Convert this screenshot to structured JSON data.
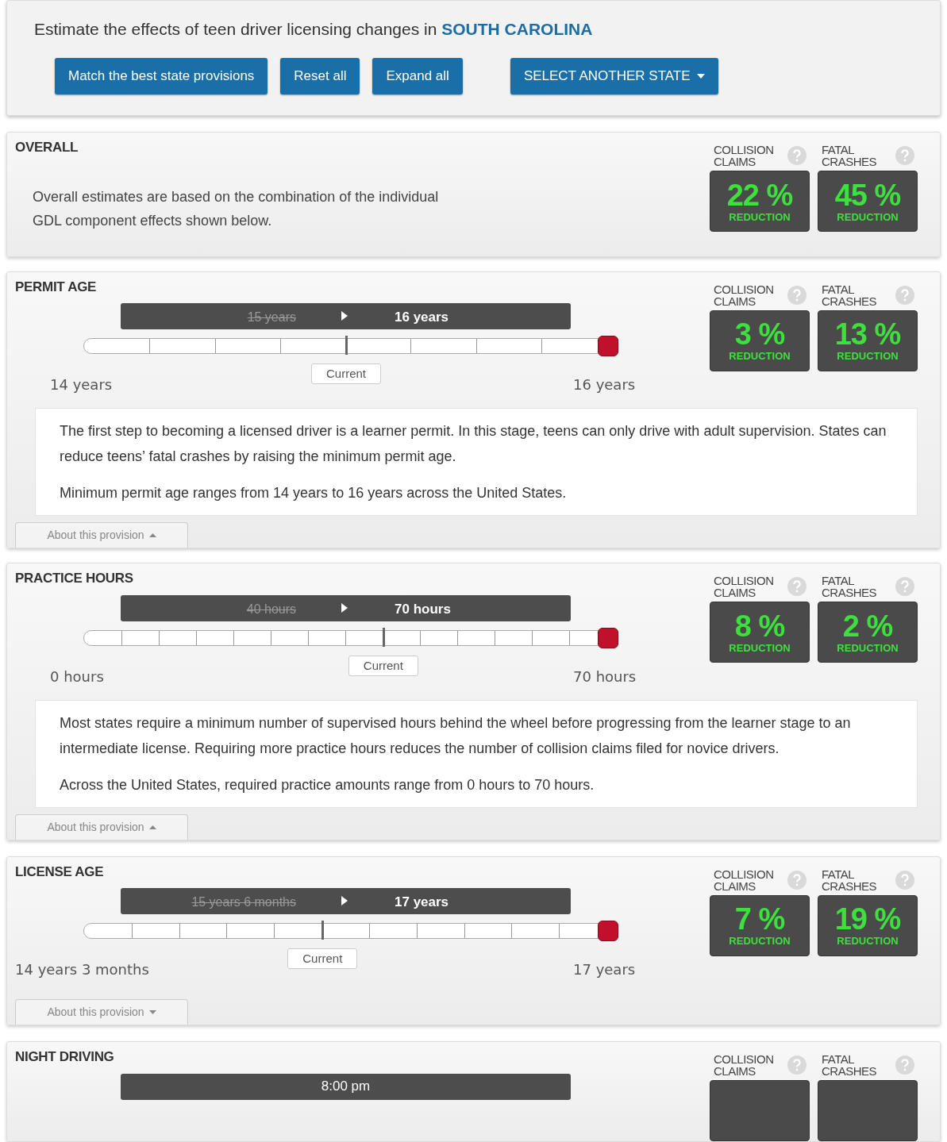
{
  "header": {
    "title": "Estimate the effects of teen driver licensing changes in **SOUTH CAROLINA**",
    "buttons": [
      {
        "label": "Match the best state provisions",
        "kind": "plain"
      },
      {
        "label": "Reset all",
        "kind": "plain"
      },
      {
        "label": "Expand all",
        "kind": "plain"
      },
      {
        "label": "SELECT ANOTHER STATE",
        "kind": "dropdown"
      }
    ]
  },
  "sections": [
    {
      "kind": "overall",
      "title": "OVERALL",
      "summary": "Overall estimates are based on the combination of the individual GDL component effects shown below.",
      "metrics": [
        {
          "label": "COLLISION CLAIMS",
          "value": "22 %",
          "unit": "REDUCTION"
        },
        {
          "label": "FATAL CRASHES",
          "value": "45 %",
          "unit": "REDUCTION"
        }
      ]
    },
    {
      "kind": "slider",
      "title": "PERMIT AGE",
      "from_value": "15 years",
      "to_value": "16 years",
      "level": 1,
      "current": {
        "label": "Current",
        "level": 0.5
      },
      "min_label": "14 years",
      "max_label": "16 years",
      "expanded": true,
      "paragraphs": [
        "The first step to becoming a licensed driver is a learner permit. In this stage, teens can only drive with adult supervision. States can reduce teens’ fatal crashes by raising the minimum permit age.",
        "Minimum permit age ranges from 14 years to 16 years across the United States."
      ],
      "about": "About this provision",
      "metrics": [
        {
          "label": "COLLISION CLAIMS",
          "value": "3 %",
          "unit": "REDUCTION"
        },
        {
          "label": "FATAL CRASHES",
          "value": "13 %",
          "unit": "REDUCTION"
        }
      ]
    },
    {
      "kind": "slider",
      "title": "PRACTICE HOURS",
      "from_value": "40 hours",
      "to_value": "70 hours",
      "level": 1,
      "current": {
        "label": "Current",
        "level": 0.571
      },
      "min_label": "0 hours",
      "max_label": "70 hours",
      "expanded": true,
      "paragraphs": [
        "Most states require a minimum number of supervised hours behind the wheel before progressing from the learner stage to an intermediate license. Requiring more practice hours reduces the number of collision claims filed for novice drivers.",
        "Across the United States, required practice amounts range from 0 hours to 70 hours."
      ],
      "about": "About this provision",
      "metrics": [
        {
          "label": "COLLISION CLAIMS",
          "value": "8 %",
          "unit": "REDUCTION"
        },
        {
          "label": "FATAL CRASHES",
          "value": "2 %",
          "unit": "REDUCTION"
        }
      ]
    },
    {
      "kind": "slider",
      "title": "LICENSE AGE",
      "from_value": "15 years 6 months",
      "to_value": "17 years",
      "level": 1,
      "current": {
        "label": "Current",
        "level": 0.455
      },
      "min_label": "14 years 3 months",
      "max_label": "17 years",
      "expanded": false,
      "about": "About this provision",
      "metrics": [
        {
          "label": "COLLISION CLAIMS",
          "value": "7 %",
          "unit": "REDUCTION"
        },
        {
          "label": "FATAL CRASHES",
          "value": "19 %",
          "unit": "REDUCTION"
        }
      ]
    },
    {
      "kind": "cut",
      "title": "NIGHT DRIVING",
      "to_value": "8:00 pm",
      "metrics": [
        {
          "label": "COLLISION CLAIMS"
        },
        {
          "label": "FATAL CRASHES"
        }
      ]
    }
  ]
}
